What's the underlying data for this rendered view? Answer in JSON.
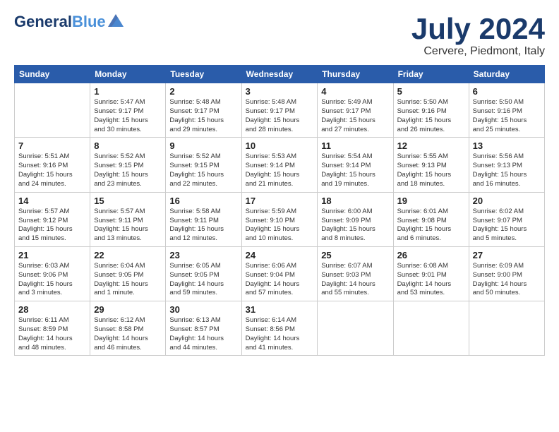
{
  "header": {
    "logo_general": "General",
    "logo_blue": "Blue",
    "month": "July 2024",
    "location": "Cervere, Piedmont, Italy"
  },
  "columns": [
    "Sunday",
    "Monday",
    "Tuesday",
    "Wednesday",
    "Thursday",
    "Friday",
    "Saturday"
  ],
  "weeks": [
    [
      {
        "day": "",
        "info": ""
      },
      {
        "day": "1",
        "info": "Sunrise: 5:47 AM\nSunset: 9:17 PM\nDaylight: 15 hours\nand 30 minutes."
      },
      {
        "day": "2",
        "info": "Sunrise: 5:48 AM\nSunset: 9:17 PM\nDaylight: 15 hours\nand 29 minutes."
      },
      {
        "day": "3",
        "info": "Sunrise: 5:48 AM\nSunset: 9:17 PM\nDaylight: 15 hours\nand 28 minutes."
      },
      {
        "day": "4",
        "info": "Sunrise: 5:49 AM\nSunset: 9:17 PM\nDaylight: 15 hours\nand 27 minutes."
      },
      {
        "day": "5",
        "info": "Sunrise: 5:50 AM\nSunset: 9:16 PM\nDaylight: 15 hours\nand 26 minutes."
      },
      {
        "day": "6",
        "info": "Sunrise: 5:50 AM\nSunset: 9:16 PM\nDaylight: 15 hours\nand 25 minutes."
      }
    ],
    [
      {
        "day": "7",
        "info": "Sunrise: 5:51 AM\nSunset: 9:16 PM\nDaylight: 15 hours\nand 24 minutes."
      },
      {
        "day": "8",
        "info": "Sunrise: 5:52 AM\nSunset: 9:15 PM\nDaylight: 15 hours\nand 23 minutes."
      },
      {
        "day": "9",
        "info": "Sunrise: 5:52 AM\nSunset: 9:15 PM\nDaylight: 15 hours\nand 22 minutes."
      },
      {
        "day": "10",
        "info": "Sunrise: 5:53 AM\nSunset: 9:14 PM\nDaylight: 15 hours\nand 21 minutes."
      },
      {
        "day": "11",
        "info": "Sunrise: 5:54 AM\nSunset: 9:14 PM\nDaylight: 15 hours\nand 19 minutes."
      },
      {
        "day": "12",
        "info": "Sunrise: 5:55 AM\nSunset: 9:13 PM\nDaylight: 15 hours\nand 18 minutes."
      },
      {
        "day": "13",
        "info": "Sunrise: 5:56 AM\nSunset: 9:13 PM\nDaylight: 15 hours\nand 16 minutes."
      }
    ],
    [
      {
        "day": "14",
        "info": "Sunrise: 5:57 AM\nSunset: 9:12 PM\nDaylight: 15 hours\nand 15 minutes."
      },
      {
        "day": "15",
        "info": "Sunrise: 5:57 AM\nSunset: 9:11 PM\nDaylight: 15 hours\nand 13 minutes."
      },
      {
        "day": "16",
        "info": "Sunrise: 5:58 AM\nSunset: 9:11 PM\nDaylight: 15 hours\nand 12 minutes."
      },
      {
        "day": "17",
        "info": "Sunrise: 5:59 AM\nSunset: 9:10 PM\nDaylight: 15 hours\nand 10 minutes."
      },
      {
        "day": "18",
        "info": "Sunrise: 6:00 AM\nSunset: 9:09 PM\nDaylight: 15 hours\nand 8 minutes."
      },
      {
        "day": "19",
        "info": "Sunrise: 6:01 AM\nSunset: 9:08 PM\nDaylight: 15 hours\nand 6 minutes."
      },
      {
        "day": "20",
        "info": "Sunrise: 6:02 AM\nSunset: 9:07 PM\nDaylight: 15 hours\nand 5 minutes."
      }
    ],
    [
      {
        "day": "21",
        "info": "Sunrise: 6:03 AM\nSunset: 9:06 PM\nDaylight: 15 hours\nand 3 minutes."
      },
      {
        "day": "22",
        "info": "Sunrise: 6:04 AM\nSunset: 9:05 PM\nDaylight: 15 hours\nand 1 minute."
      },
      {
        "day": "23",
        "info": "Sunrise: 6:05 AM\nSunset: 9:05 PM\nDaylight: 14 hours\nand 59 minutes."
      },
      {
        "day": "24",
        "info": "Sunrise: 6:06 AM\nSunset: 9:04 PM\nDaylight: 14 hours\nand 57 minutes."
      },
      {
        "day": "25",
        "info": "Sunrise: 6:07 AM\nSunset: 9:03 PM\nDaylight: 14 hours\nand 55 minutes."
      },
      {
        "day": "26",
        "info": "Sunrise: 6:08 AM\nSunset: 9:01 PM\nDaylight: 14 hours\nand 53 minutes."
      },
      {
        "day": "27",
        "info": "Sunrise: 6:09 AM\nSunset: 9:00 PM\nDaylight: 14 hours\nand 50 minutes."
      }
    ],
    [
      {
        "day": "28",
        "info": "Sunrise: 6:11 AM\nSunset: 8:59 PM\nDaylight: 14 hours\nand 48 minutes."
      },
      {
        "day": "29",
        "info": "Sunrise: 6:12 AM\nSunset: 8:58 PM\nDaylight: 14 hours\nand 46 minutes."
      },
      {
        "day": "30",
        "info": "Sunrise: 6:13 AM\nSunset: 8:57 PM\nDaylight: 14 hours\nand 44 minutes."
      },
      {
        "day": "31",
        "info": "Sunrise: 6:14 AM\nSunset: 8:56 PM\nDaylight: 14 hours\nand 41 minutes."
      },
      {
        "day": "",
        "info": ""
      },
      {
        "day": "",
        "info": ""
      },
      {
        "day": "",
        "info": ""
      }
    ]
  ]
}
